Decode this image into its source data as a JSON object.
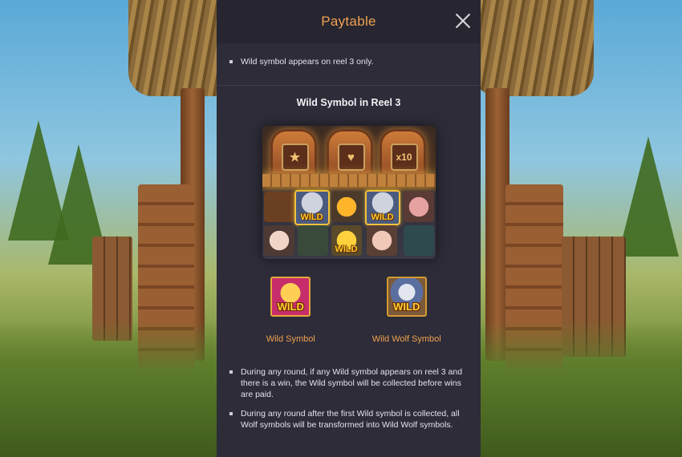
{
  "panel": {
    "title": "Paytable",
    "close_icon": "close-icon"
  },
  "top_bullets": [
    "Wild symbol appears on reel 3 only."
  ],
  "section": {
    "title": "Wild Symbol in Reel 3"
  },
  "reel": {
    "multiplier": "x10",
    "wild_text": "WILD"
  },
  "symbols": [
    {
      "label": "Wild Symbol",
      "icon": "wild-pig-icon",
      "text": "WILD"
    },
    {
      "label": "Wild Wolf Symbol",
      "icon": "wild-wolf-icon",
      "text": "WILD"
    }
  ],
  "bottom_bullets": [
    "During any round, if any Wild symbol appears on reel 3 and there is a win, the Wild symbol will be collected before wins are paid.",
    "During any round after the first Wild symbol is collected, all Wolf symbols will be transformed into Wild Wolf symbols."
  ],
  "colors": {
    "accent": "#f0a150",
    "panel_bg": "#2d2c38",
    "header_bg": "#272630"
  }
}
